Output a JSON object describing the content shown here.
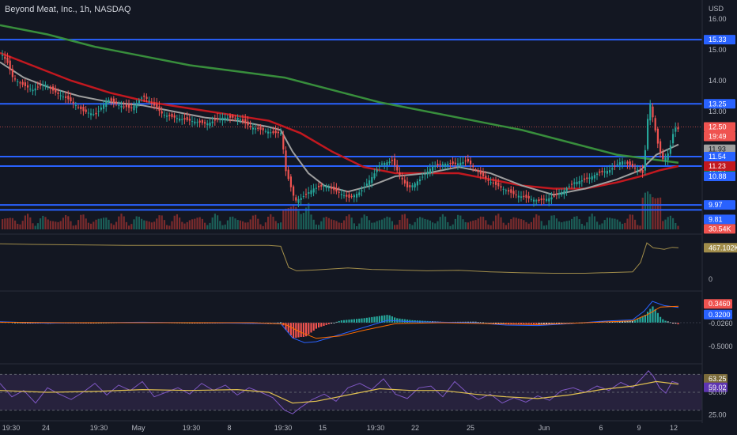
{
  "header": {
    "title": "Beyond Meat, Inc., 1h, NASDAQ",
    "currency": "USD"
  },
  "x_axis": {
    "ticks": [
      "19:30",
      "24",
      "19:30",
      "May",
      "19:30",
      "8",
      "19:30",
      "15",
      "19:30",
      "22",
      "25",
      "Jun",
      "6",
      "9",
      "12"
    ]
  },
  "colors": {
    "background": "#131722",
    "up": "#26a69a",
    "down": "#ef5350",
    "level_line": "#2962ff",
    "sma_red": "#c2181f",
    "sma_green": "#388e3c",
    "sma_gray": "#9e9e9e",
    "obv_line": "#a08c4a",
    "macd_line": "#2962ff",
    "signal_line": "#ff6d00",
    "rsi_line": "#7e57c2",
    "rsi_ma": "#e0c050",
    "rsi_band": "#2a2340"
  },
  "chart_data": [
    {
      "type": "candlestick",
      "title": "Beyond Meat, Inc., 1h, NASDAQ",
      "y_ticks": [
        "16.00",
        "15.00",
        "14.00",
        "13.00"
      ],
      "ylim": [
        9.5,
        16.3
      ],
      "horizontal_levels": [
        15.33,
        13.25,
        11.54,
        11.23,
        9.97,
        9.81
      ],
      "price_labels": [
        {
          "text": "15.33",
          "kind": "level"
        },
        {
          "text": "13.25",
          "kind": "level"
        },
        {
          "text": "12.50",
          "kind": "last_price"
        },
        {
          "text": "19:49",
          "kind": "countdown"
        },
        {
          "text": "11.93",
          "kind": "sma_gray"
        },
        {
          "text": "11.54",
          "kind": "level"
        },
        {
          "text": "11.34",
          "kind": "sma_green"
        },
        {
          "text": "11.23",
          "kind": "sma_red"
        },
        {
          "text": "10.88",
          "kind": "level"
        },
        {
          "text": "9.97",
          "kind": "level"
        },
        {
          "text": "9.81",
          "kind": "level"
        },
        {
          "text": "30.54K",
          "kind": "volume"
        }
      ],
      "price_path": [
        [
          0,
          14.9
        ],
        [
          8,
          14.6
        ],
        [
          15,
          14.1
        ],
        [
          25,
          13.9
        ],
        [
          40,
          13.7
        ],
        [
          55,
          13.9
        ],
        [
          70,
          13.6
        ],
        [
          85,
          13.4
        ],
        [
          95,
          13.2
        ],
        [
          105,
          13.0
        ],
        [
          120,
          12.9
        ],
        [
          135,
          13.4
        ],
        [
          150,
          13.2
        ],
        [
          165,
          13.1
        ],
        [
          180,
          13.5
        ],
        [
          190,
          13.3
        ],
        [
          205,
          12.9
        ],
        [
          220,
          12.8
        ],
        [
          240,
          12.7
        ],
        [
          260,
          12.6
        ],
        [
          280,
          12.8
        ],
        [
          300,
          12.8
        ],
        [
          315,
          12.5
        ],
        [
          330,
          12.4
        ],
        [
          345,
          12.3
        ],
        [
          355,
          12.3
        ],
        [
          360,
          11.1
        ],
        [
          365,
          10.7
        ],
        [
          372,
          10.1
        ],
        [
          380,
          10.2
        ],
        [
          395,
          10.5
        ],
        [
          410,
          10.6
        ],
        [
          425,
          10.4
        ],
        [
          440,
          10.2
        ],
        [
          455,
          10.4
        ],
        [
          470,
          10.9
        ],
        [
          480,
          11.3
        ],
        [
          495,
          11.4
        ],
        [
          505,
          10.9
        ],
        [
          515,
          10.5
        ],
        [
          530,
          10.8
        ],
        [
          545,
          11.2
        ],
        [
          560,
          11.3
        ],
        [
          575,
          11.3
        ],
        [
          590,
          11.4
        ],
        [
          605,
          11.0
        ],
        [
          620,
          10.7
        ],
        [
          635,
          10.5
        ],
        [
          650,
          10.3
        ],
        [
          665,
          10.2
        ],
        [
          680,
          10.1
        ],
        [
          695,
          10.2
        ],
        [
          710,
          10.4
        ],
        [
          725,
          10.7
        ],
        [
          740,
          10.8
        ],
        [
          755,
          11.0
        ],
        [
          770,
          11.1
        ],
        [
          785,
          11.4
        ],
        [
          800,
          11.2
        ],
        [
          812,
          11.0
        ],
        [
          815,
          11.8
        ],
        [
          820,
          13.4
        ],
        [
          826,
          12.6
        ],
        [
          832,
          11.8
        ],
        [
          838,
          11.4
        ],
        [
          845,
          11.7
        ],
        [
          852,
          12.5
        ],
        [
          858,
          12.4
        ]
      ],
      "sma_gray_path": [
        [
          0,
          14.6
        ],
        [
          30,
          14.1
        ],
        [
          60,
          13.8
        ],
        [
          100,
          13.5
        ],
        [
          140,
          13.3
        ],
        [
          180,
          13.2
        ],
        [
          220,
          13.0
        ],
        [
          260,
          12.8
        ],
        [
          300,
          12.7
        ],
        [
          340,
          12.5
        ],
        [
          355,
          12.4
        ],
        [
          370,
          11.7
        ],
        [
          390,
          11.0
        ],
        [
          410,
          10.6
        ],
        [
          440,
          10.4
        ],
        [
          470,
          10.6
        ],
        [
          500,
          10.9
        ],
        [
          540,
          11.0
        ],
        [
          580,
          11.2
        ],
        [
          620,
          11.0
        ],
        [
          660,
          10.6
        ],
        [
          700,
          10.3
        ],
        [
          740,
          10.5
        ],
        [
          780,
          10.8
        ],
        [
          810,
          11.1
        ],
        [
          830,
          11.6
        ],
        [
          858,
          11.93
        ]
      ],
      "sma_red_path": [
        [
          0,
          14.9
        ],
        [
          40,
          14.5
        ],
        [
          90,
          14.0
        ],
        [
          140,
          13.6
        ],
        [
          190,
          13.3
        ],
        [
          240,
          13.1
        ],
        [
          290,
          12.9
        ],
        [
          340,
          12.7
        ],
        [
          380,
          12.3
        ],
        [
          420,
          11.7
        ],
        [
          460,
          11.2
        ],
        [
          500,
          11.0
        ],
        [
          540,
          11.0
        ],
        [
          580,
          11.0
        ],
        [
          620,
          10.8
        ],
        [
          660,
          10.6
        ],
        [
          700,
          10.5
        ],
        [
          740,
          10.5
        ],
        [
          780,
          10.7
        ],
        [
          810,
          10.9
        ],
        [
          835,
          11.1
        ],
        [
          858,
          11.23
        ]
      ],
      "sma_green_path": [
        [
          0,
          15.8
        ],
        [
          60,
          15.5
        ],
        [
          120,
          15.1
        ],
        [
          180,
          14.8
        ],
        [
          240,
          14.5
        ],
        [
          300,
          14.3
        ],
        [
          360,
          14.1
        ],
        [
          420,
          13.7
        ],
        [
          480,
          13.3
        ],
        [
          540,
          13.0
        ],
        [
          600,
          12.7
        ],
        [
          660,
          12.4
        ],
        [
          720,
          12.0
        ],
        [
          780,
          11.6
        ],
        [
          858,
          11.34
        ]
      ]
    },
    {
      "type": "area",
      "title": "",
      "y_ticks": [
        "0"
      ],
      "value_label": "467.102K",
      "obv_path": [
        [
          0,
          0.93
        ],
        [
          40,
          0.92
        ],
        [
          100,
          0.91
        ],
        [
          160,
          0.9
        ],
        [
          220,
          0.9
        ],
        [
          280,
          0.9
        ],
        [
          340,
          0.9
        ],
        [
          355,
          0.88
        ],
        [
          365,
          0.45
        ],
        [
          375,
          0.38
        ],
        [
          400,
          0.4
        ],
        [
          440,
          0.44
        ],
        [
          470,
          0.41
        ],
        [
          500,
          0.4
        ],
        [
          540,
          0.38
        ],
        [
          580,
          0.39
        ],
        [
          620,
          0.36
        ],
        [
          660,
          0.34
        ],
        [
          700,
          0.33
        ],
        [
          740,
          0.33
        ],
        [
          800,
          0.36
        ],
        [
          810,
          0.55
        ],
        [
          818,
          0.95
        ],
        [
          826,
          0.85
        ],
        [
          840,
          0.82
        ],
        [
          850,
          0.86
        ],
        [
          858,
          0.85
        ]
      ]
    },
    {
      "type": "bar",
      "title": "",
      "y_ticks": [
        "-0.5000"
      ],
      "value_labels": [
        "0.3460",
        "0.3200",
        "-0.0260"
      ],
      "macd_path": [
        [
          0,
          0.02
        ],
        [
          60,
          -0.01
        ],
        [
          120,
          0.0
        ],
        [
          180,
          0.01
        ],
        [
          240,
          0.0
        ],
        [
          300,
          -0.01
        ],
        [
          355,
          -0.02
        ],
        [
          370,
          -0.32
        ],
        [
          385,
          -0.42
        ],
        [
          400,
          -0.4
        ],
        [
          430,
          -0.25
        ],
        [
          460,
          -0.1
        ],
        [
          490,
          0.05
        ],
        [
          520,
          0.02
        ],
        [
          560,
          0.01
        ],
        [
          600,
          0.0
        ],
        [
          640,
          -0.05
        ],
        [
          680,
          -0.06
        ],
        [
          720,
          -0.02
        ],
        [
          760,
          0.03
        ],
        [
          800,
          0.06
        ],
        [
          815,
          0.25
        ],
        [
          825,
          0.45
        ],
        [
          840,
          0.36
        ],
        [
          858,
          0.32
        ]
      ],
      "signal_path": [
        [
          0,
          0.01
        ],
        [
          80,
          0.0
        ],
        [
          160,
          0.0
        ],
        [
          240,
          0.0
        ],
        [
          320,
          0.0
        ],
        [
          360,
          -0.03
        ],
        [
          380,
          -0.2
        ],
        [
          400,
          -0.33
        ],
        [
          430,
          -0.28
        ],
        [
          460,
          -0.16
        ],
        [
          500,
          -0.02
        ],
        [
          560,
          0.0
        ],
        [
          620,
          -0.02
        ],
        [
          680,
          -0.04
        ],
        [
          740,
          0.0
        ],
        [
          800,
          0.04
        ],
        [
          820,
          0.18
        ],
        [
          835,
          0.33
        ],
        [
          858,
          0.346
        ]
      ]
    },
    {
      "type": "line",
      "title": "",
      "y_ticks": [
        "50.00",
        "25.00"
      ],
      "value_labels": [
        "63.25",
        "59.02"
      ],
      "ylim": [
        20,
        80
      ],
      "rsi_path": [
        [
          0,
          60
        ],
        [
          15,
          45
        ],
        [
          30,
          52
        ],
        [
          45,
          38
        ],
        [
          60,
          55
        ],
        [
          75,
          48
        ],
        [
          90,
          42
        ],
        [
          105,
          50
        ],
        [
          120,
          60
        ],
        [
          135,
          47
        ],
        [
          150,
          58
        ],
        [
          165,
          52
        ],
        [
          180,
          62
        ],
        [
          195,
          45
        ],
        [
          210,
          50
        ],
        [
          225,
          55
        ],
        [
          240,
          48
        ],
        [
          255,
          60
        ],
        [
          270,
          52
        ],
        [
          285,
          58
        ],
        [
          300,
          47
        ],
        [
          315,
          55
        ],
        [
          330,
          50
        ],
        [
          345,
          44
        ],
        [
          360,
          30
        ],
        [
          370,
          26
        ],
        [
          380,
          33
        ],
        [
          395,
          42
        ],
        [
          410,
          48
        ],
        [
          425,
          40
        ],
        [
          440,
          55
        ],
        [
          455,
          60
        ],
        [
          470,
          53
        ],
        [
          485,
          65
        ],
        [
          500,
          48
        ],
        [
          515,
          43
        ],
        [
          530,
          55
        ],
        [
          545,
          57
        ],
        [
          560,
          45
        ],
        [
          575,
          62
        ],
        [
          590,
          50
        ],
        [
          605,
          42
        ],
        [
          620,
          48
        ],
        [
          635,
          38
        ],
        [
          650,
          44
        ],
        [
          665,
          39
        ],
        [
          680,
          46
        ],
        [
          695,
          41
        ],
        [
          710,
          52
        ],
        [
          725,
          55
        ],
        [
          740,
          50
        ],
        [
          755,
          57
        ],
        [
          770,
          52
        ],
        [
          785,
          61
        ],
        [
          800,
          55
        ],
        [
          812,
          66
        ],
        [
          820,
          74
        ],
        [
          826,
          68
        ],
        [
          834,
          55
        ],
        [
          842,
          49
        ],
        [
          850,
          62
        ],
        [
          858,
          60
        ]
      ],
      "rsi_ma_path": [
        [
          0,
          52
        ],
        [
          60,
          50
        ],
        [
          120,
          51
        ],
        [
          180,
          53
        ],
        [
          240,
          52
        ],
        [
          300,
          53
        ],
        [
          340,
          50
        ],
        [
          370,
          38
        ],
        [
          400,
          40
        ],
        [
          440,
          47
        ],
        [
          480,
          54
        ],
        [
          520,
          52
        ],
        [
          560,
          52
        ],
        [
          600,
          48
        ],
        [
          640,
          45
        ],
        [
          680,
          43
        ],
        [
          720,
          47
        ],
        [
          760,
          53
        ],
        [
          800,
          57
        ],
        [
          830,
          62
        ],
        [
          858,
          59
        ]
      ]
    }
  ]
}
